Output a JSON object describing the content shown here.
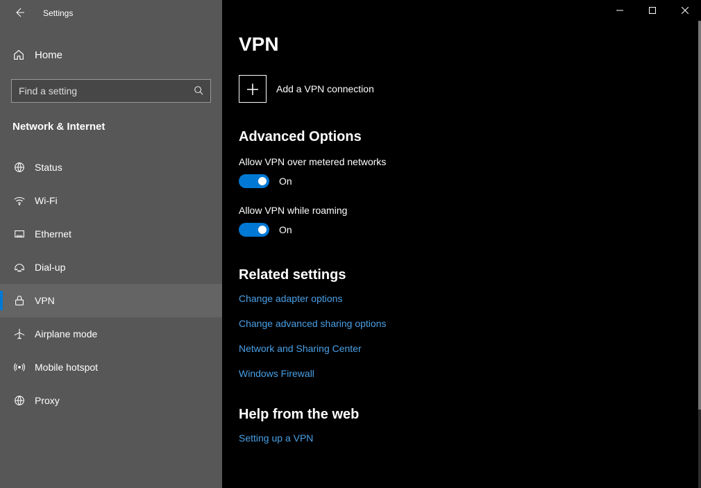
{
  "app_title": "Settings",
  "home_label": "Home",
  "search_placeholder": "Find a setting",
  "category": "Network & Internet",
  "nav": [
    {
      "key": "status",
      "label": "Status",
      "selected": false
    },
    {
      "key": "wifi",
      "label": "Wi-Fi",
      "selected": false
    },
    {
      "key": "ethernet",
      "label": "Ethernet",
      "selected": false
    },
    {
      "key": "dialup",
      "label": "Dial-up",
      "selected": false
    },
    {
      "key": "vpn",
      "label": "VPN",
      "selected": true
    },
    {
      "key": "airplane",
      "label": "Airplane mode",
      "selected": false
    },
    {
      "key": "hotspot",
      "label": "Mobile hotspot",
      "selected": false
    },
    {
      "key": "proxy",
      "label": "Proxy",
      "selected": false
    }
  ],
  "page_title": "VPN",
  "add_vpn_label": "Add a VPN connection",
  "advanced_h": "Advanced Options",
  "toggle_metered": {
    "label": "Allow VPN over metered networks",
    "state": "On"
  },
  "toggle_roaming": {
    "label": "Allow VPN while roaming",
    "state": "On"
  },
  "related_h": "Related settings",
  "related_links": [
    "Change adapter options",
    "Change advanced sharing options",
    "Network and Sharing Center",
    "Windows Firewall"
  ],
  "help_h": "Help from the web",
  "help_links": [
    "Setting up a VPN"
  ],
  "colors": {
    "accent": "#0078d4",
    "link": "#4aa0e6"
  }
}
